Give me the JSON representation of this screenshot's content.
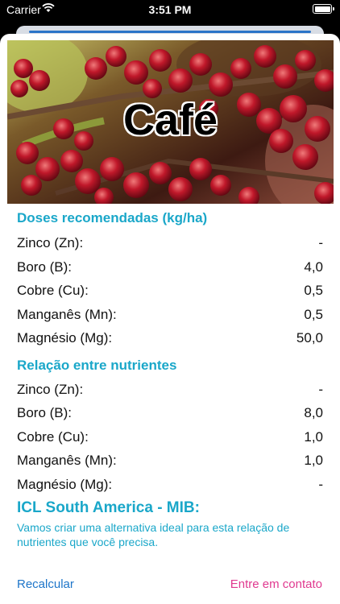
{
  "status_bar": {
    "carrier": "Carrier",
    "time": "3:51 PM"
  },
  "crop": {
    "name": "Café"
  },
  "doses": {
    "title": "Doses recomendadas (kg/ha)",
    "rows": [
      {
        "label": "Zinco (Zn):",
        "value": "-"
      },
      {
        "label": "Boro (B):",
        "value": "4,0"
      },
      {
        "label": "Cobre (Cu):",
        "value": "0,5"
      },
      {
        "label": "Manganês (Mn):",
        "value": "0,5"
      },
      {
        "label": "Magnésio (Mg):",
        "value": "50,0"
      }
    ]
  },
  "ratio": {
    "title": "Relação entre nutrientes",
    "rows": [
      {
        "label": "Zinco (Zn):",
        "value": "-"
      },
      {
        "label": "Boro (B):",
        "value": "8,0"
      },
      {
        "label": "Cobre (Cu):",
        "value": "1,0"
      },
      {
        "label": "Manganês (Mn):",
        "value": "1,0"
      },
      {
        "label": "Magnésio (Mg):",
        "value": "-"
      }
    ]
  },
  "promo": {
    "title": "ICL South America - MIB:",
    "text": "Vamos criar uma alternativa ideal para esta relação de nutrientes que você precisa."
  },
  "actions": {
    "recalculate": "Recalcular",
    "contact": "Entre em contato"
  },
  "colors": {
    "accent": "#1aa7c9",
    "link": "#1d75c9",
    "contact": "#e0398f"
  }
}
